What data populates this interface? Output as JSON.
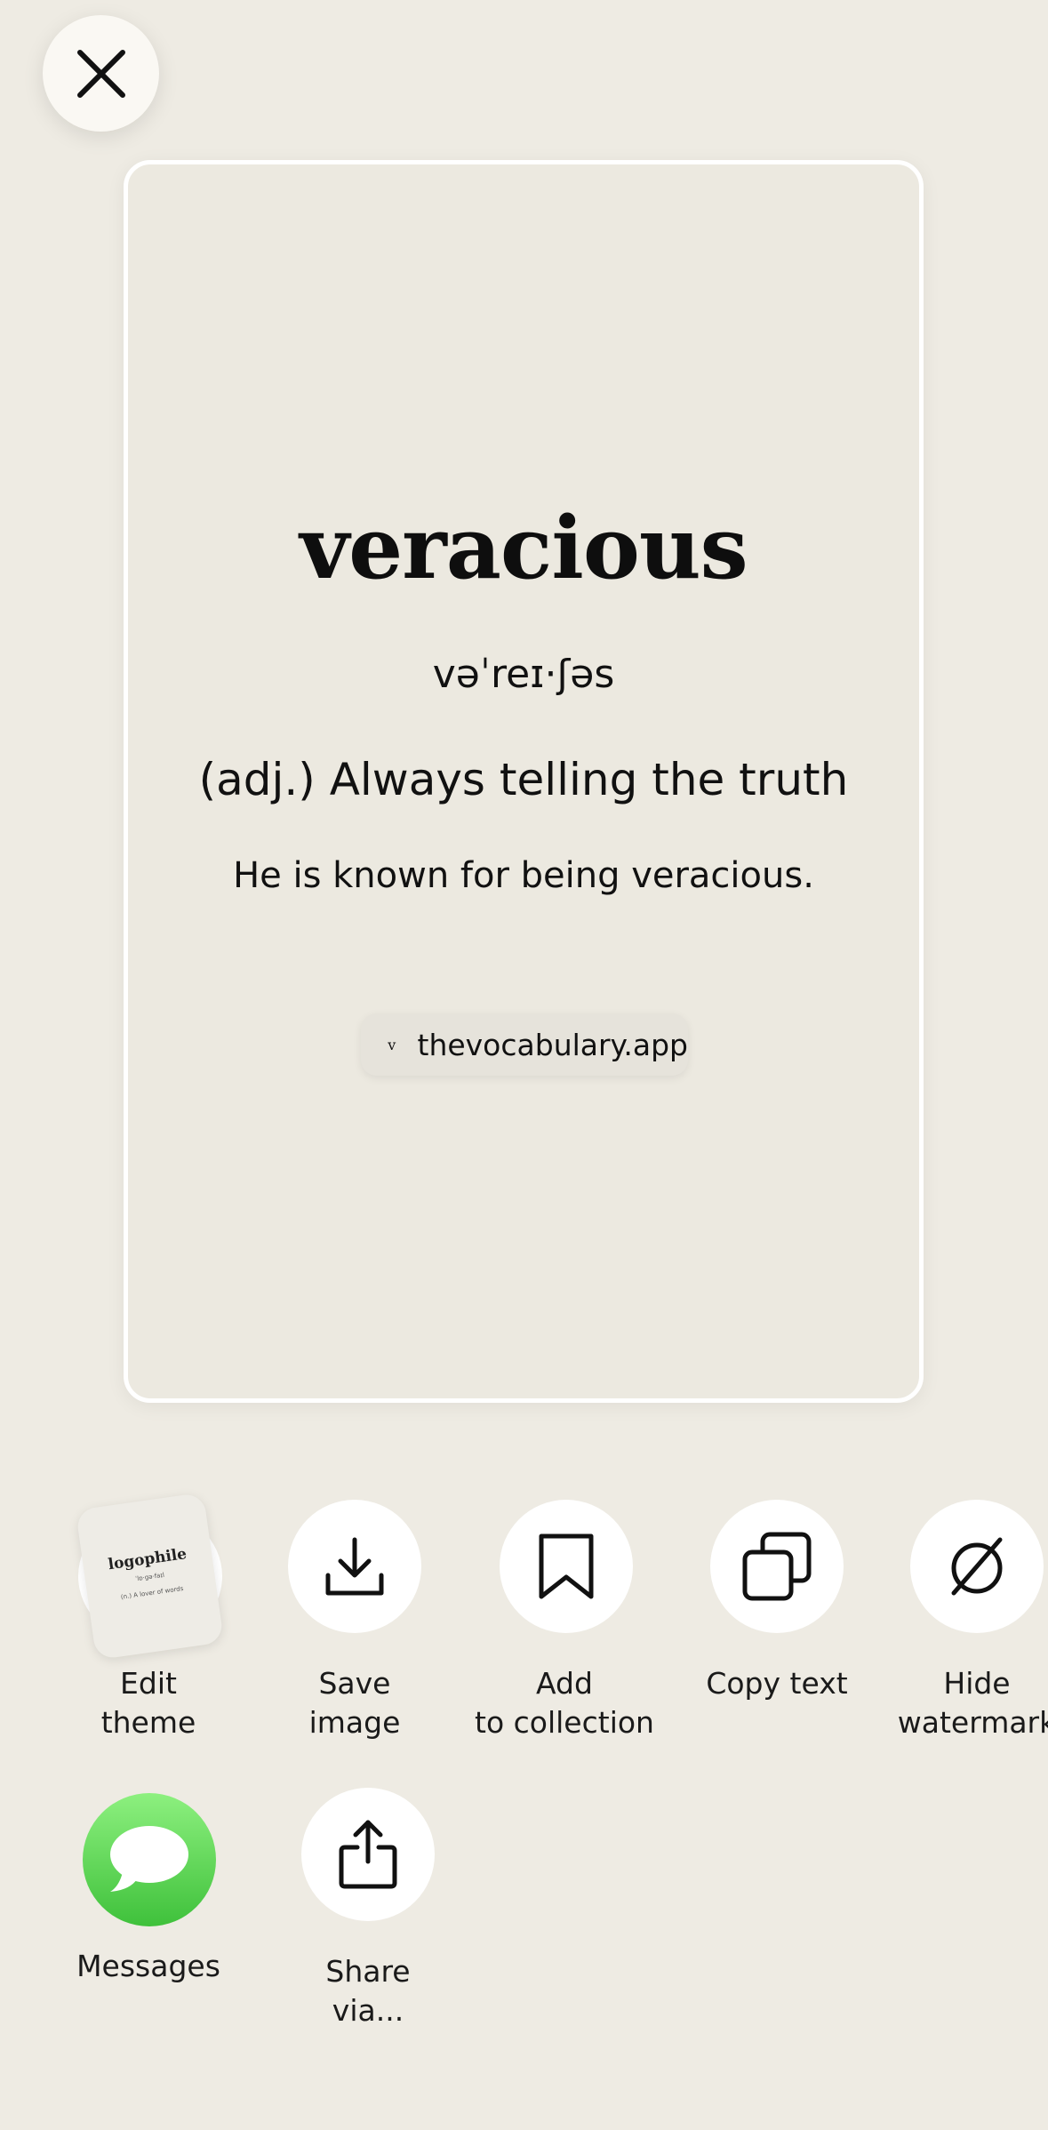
{
  "close_button": {
    "icon": "close-icon"
  },
  "card": {
    "word": "veracious",
    "phonetic": "vəˈreɪ·ʃəs",
    "definition": "(adj.) Always telling the truth",
    "example": "He is known for being veracious.",
    "watermark": {
      "logo_glyph": "v",
      "url": "thevocabulary.app"
    }
  },
  "actions_row1": [
    {
      "label": "Edit\ntheme",
      "icon": "theme-thumbnail",
      "thumb": {
        "word": "logophile",
        "phonetic": "ˈlɒ·gə·faɪl",
        "definition": "(n.) A lover of words"
      }
    },
    {
      "label": "Save\nimage",
      "icon": "download-icon"
    },
    {
      "label": "Add\nto collection",
      "icon": "bookmark-icon"
    },
    {
      "label": "Copy text",
      "icon": "copy-icon"
    },
    {
      "label": "Hide\nwatermark",
      "icon": "hide-icon"
    }
  ],
  "actions_row2": [
    {
      "label": "Messages",
      "icon": "messages-icon"
    },
    {
      "label": "Share\nvia...",
      "icon": "share-icon"
    }
  ],
  "colors": {
    "background": "#eeebe3",
    "card": "#ece9e0",
    "messages_green": "#4cd447"
  }
}
